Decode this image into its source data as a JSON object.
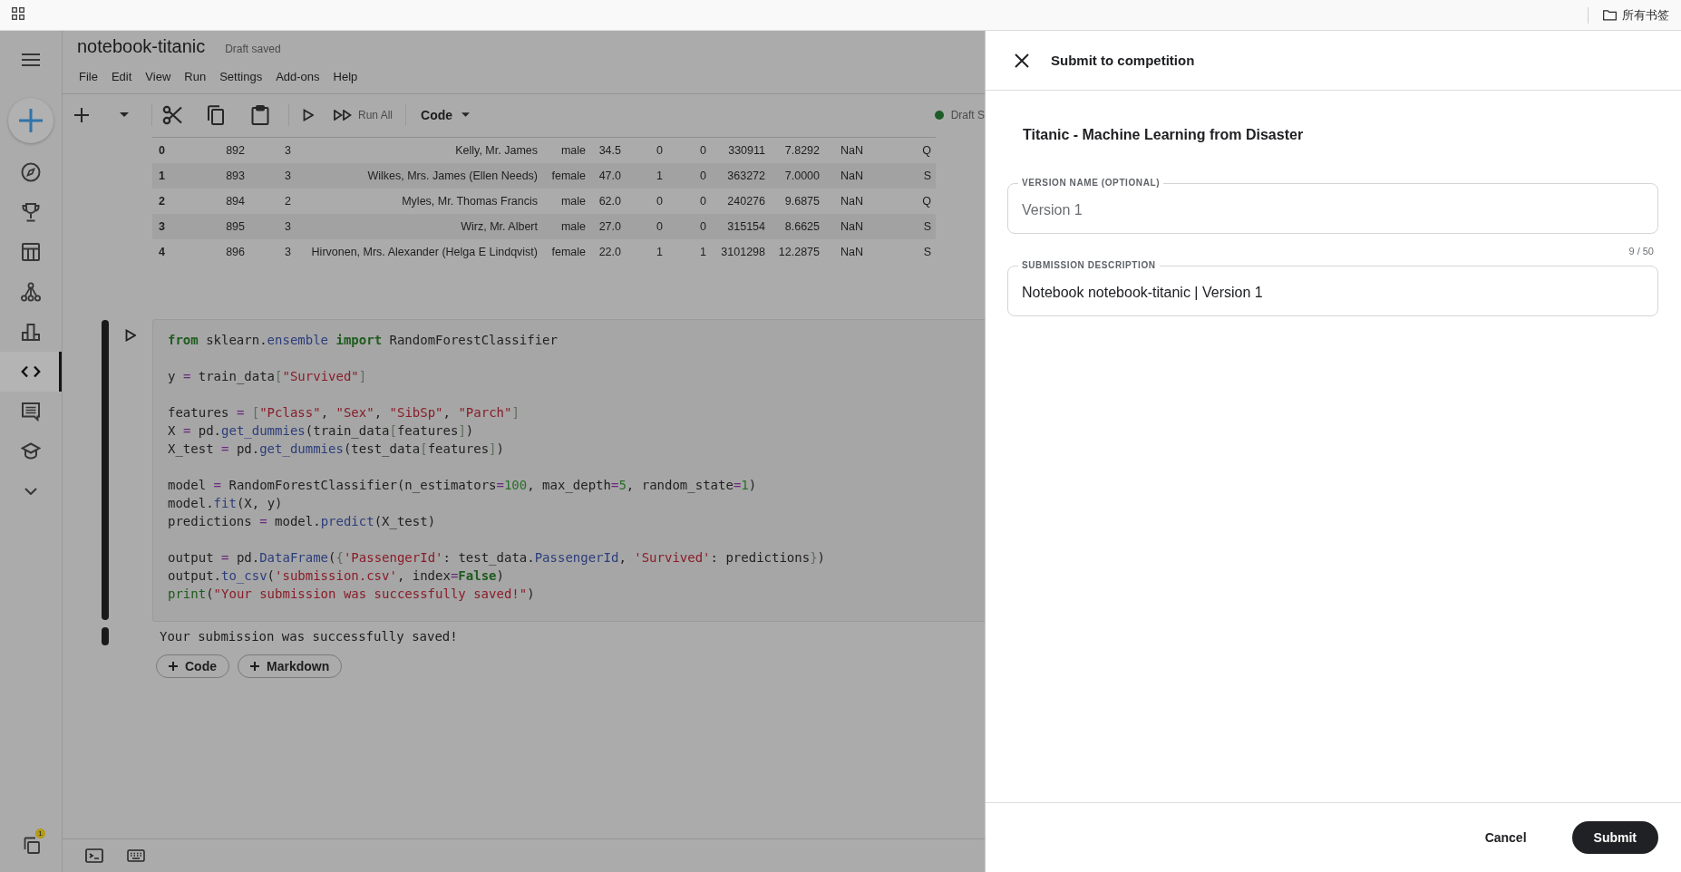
{
  "bookmarks_bar": {
    "folder_label": "所有书签"
  },
  "notebook": {
    "title": "notebook-titanic",
    "save_status": "Draft saved",
    "menu": [
      "File",
      "Edit",
      "View",
      "Run",
      "Settings",
      "Add-ons",
      "Help"
    ]
  },
  "sidebar": {
    "items": [
      {
        "selected": false
      },
      {
        "selected": false
      },
      {
        "selected": false
      },
      {
        "selected": false
      },
      {
        "selected": false
      },
      {
        "selected": true
      },
      {
        "selected": false
      },
      {
        "selected": false
      }
    ],
    "notification_badge": "1"
  },
  "toolbar": {
    "run_all_label": "Run All",
    "cell_type": "Code",
    "status": "Draft S"
  },
  "table": {
    "rows": [
      [
        "0",
        "892",
        "3",
        "Kelly, Mr. James",
        "male",
        "34.5",
        "0",
        "0",
        "330911",
        "7.8292",
        "NaN",
        "Q"
      ],
      [
        "1",
        "893",
        "3",
        "Wilkes, Mrs. James (Ellen Needs)",
        "female",
        "47.0",
        "1",
        "0",
        "363272",
        "7.0000",
        "NaN",
        "S"
      ],
      [
        "2",
        "894",
        "2",
        "Myles, Mr. Thomas Francis",
        "male",
        "62.0",
        "0",
        "0",
        "240276",
        "9.6875",
        "NaN",
        "Q"
      ],
      [
        "3",
        "895",
        "3",
        "Wirz, Mr. Albert",
        "male",
        "27.0",
        "0",
        "0",
        "315154",
        "8.6625",
        "NaN",
        "S"
      ],
      [
        "4",
        "896",
        "3",
        "Hirvonen, Mrs. Alexander (Helga E Lindqvist)",
        "female",
        "22.0",
        "1",
        "1",
        "3101298",
        "12.2875",
        "NaN",
        "S"
      ]
    ]
  },
  "code_cell": {
    "code": "from sklearn.ensemble import RandomForestClassifier\n\ny = train_data[\"Survived\"]\n\nfeatures = [\"Pclass\", \"Sex\", \"SibSp\", \"Parch\"]\nX = pd.get_dummies(train_data[features])\nX_test = pd.get_dummies(test_data[features])\n\nmodel = RandomForestClassifier(n_estimators=100, max_depth=5, random_state=1)\nmodel.fit(X, y)\npredictions = model.predict(X_test)\n\noutput = pd.DataFrame({'PassengerId': test_data.PassengerId, 'Survived': predictions})\noutput.to_csv('submission.csv', index=False)\nprint(\"Your submission was successfully saved!\")",
    "output": "Your submission was successfully saved!"
  },
  "add_cell_buttons": [
    "Code",
    "Markdown"
  ],
  "submit_panel": {
    "title": "Submit to competition",
    "competition": "Titanic - Machine Learning from Disaster",
    "fields": [
      {
        "label": "VERSION NAME (OPTIONAL)",
        "placeholder": "Version 1",
        "counter": "9 / 50"
      },
      {
        "label": "SUBMISSION DESCRIPTION",
        "value": "Notebook notebook-titanic | Version 1"
      }
    ],
    "buttons": [
      {
        "label": "Cancel",
        "kind": "text"
      },
      {
        "label": "Submit",
        "kind": "primary"
      }
    ]
  }
}
